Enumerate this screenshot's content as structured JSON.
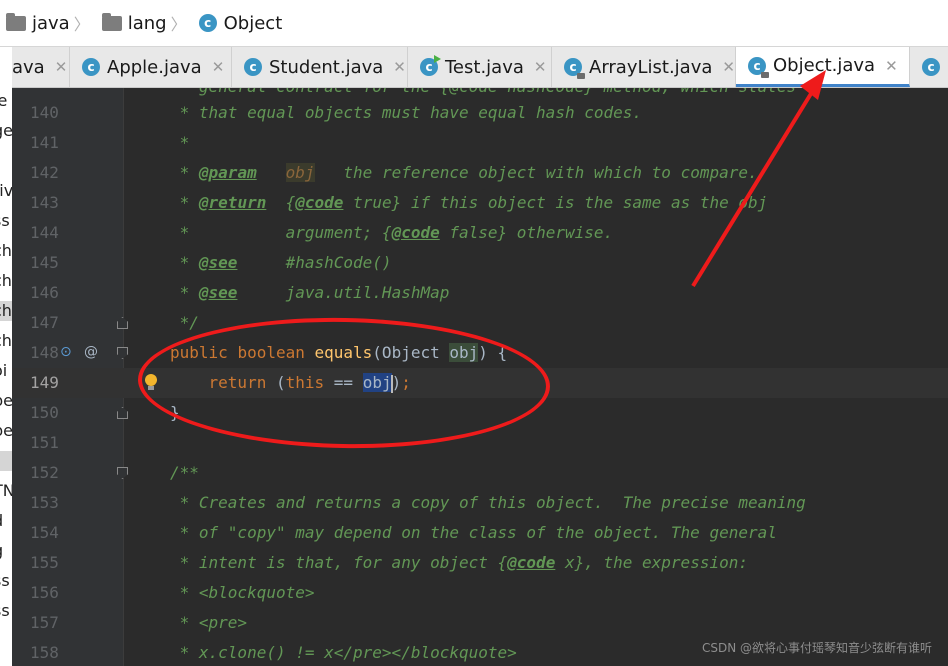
{
  "breadcrumb": {
    "items": [
      {
        "label": "java",
        "icon": "folder-icon"
      },
      {
        "label": "lang",
        "icon": "folder-icon"
      },
      {
        "label": "Object",
        "icon": "class-icon"
      }
    ]
  },
  "tabs": [
    {
      "label": "ava",
      "icon": "",
      "active": false
    },
    {
      "label": "Apple.java",
      "icon": "class-icon",
      "active": false
    },
    {
      "label": "Student.java",
      "icon": "class-icon",
      "active": false
    },
    {
      "label": "Test.java",
      "icon": "test-class-icon",
      "active": false
    },
    {
      "label": "ArrayList.java",
      "icon": "locked-class-icon",
      "active": false
    },
    {
      "label": "Object.java",
      "icon": "locked-class-icon",
      "active": true
    },
    {
      "label": "I",
      "icon": "class-icon",
      "active": false
    }
  ],
  "tab_close_glyph": "✕",
  "left_panel": {
    "fragments": [
      "le",
      "ge",
      "",
      "tiv",
      "ss",
      "ch",
      "ch",
      "ch",
      "ch",
      "oi",
      "pe",
      "pe",
      "t",
      "TN",
      "d",
      "g",
      "ss",
      "ss"
    ]
  },
  "editor": {
    "lines": [
      {
        "num": "140",
        "segments": [
          {
            "t": " * that equal objects must have equal hash codes.",
            "c": "doc"
          }
        ]
      },
      {
        "num": "141",
        "segments": [
          {
            "t": " *",
            "c": "doc"
          }
        ]
      },
      {
        "num": "142",
        "segments": [
          {
            "t": " * ",
            "c": "doc"
          },
          {
            "t": "@param",
            "c": "tag"
          },
          {
            "t": "   ",
            "c": "doc"
          },
          {
            "t": "obj",
            "c": "param"
          },
          {
            "t": "   the reference object with which to compare.",
            "c": "doc"
          }
        ]
      },
      {
        "num": "143",
        "segments": [
          {
            "t": " * ",
            "c": "doc"
          },
          {
            "t": "@return",
            "c": "tag"
          },
          {
            "t": "  {",
            "c": "doc"
          },
          {
            "t": "@code",
            "c": "tag"
          },
          {
            "t": " true} if this object is the same as the obj",
            "c": "doc"
          }
        ]
      },
      {
        "num": "144",
        "segments": [
          {
            "t": " *          argument; {",
            "c": "doc"
          },
          {
            "t": "@code",
            "c": "tag"
          },
          {
            "t": " false} otherwise.",
            "c": "doc"
          }
        ]
      },
      {
        "num": "145",
        "segments": [
          {
            "t": " * ",
            "c": "doc"
          },
          {
            "t": "@see",
            "c": "tag"
          },
          {
            "t": "     #hashCode()",
            "c": "doc"
          }
        ]
      },
      {
        "num": "146",
        "segments": [
          {
            "t": " * ",
            "c": "doc"
          },
          {
            "t": "@see",
            "c": "tag"
          },
          {
            "t": "     java.util.HashMap",
            "c": "doc"
          }
        ]
      },
      {
        "num": "147",
        "segments": [
          {
            "t": " */",
            "c": "doc"
          }
        ]
      },
      {
        "num": "148",
        "segments": [
          {
            "t": "public ",
            "c": "kw"
          },
          {
            "t": "boolean ",
            "c": "kw"
          },
          {
            "t": "equals",
            "c": "fn"
          },
          {
            "t": "(Object ",
            "c": "plain"
          },
          {
            "t": "obj",
            "c": "varhl"
          },
          {
            "t": ") {",
            "c": "plain"
          }
        ]
      },
      {
        "num": "149",
        "current": true,
        "segments": [
          {
            "t": "    return ",
            "c": "kw"
          },
          {
            "t": "(",
            "c": "plain"
          },
          {
            "t": "this ",
            "c": "kw"
          },
          {
            "t": "== ",
            "c": "plain"
          },
          {
            "t": "obj",
            "c": "sel-word"
          },
          {
            "t": ")",
            "c": "plain"
          },
          {
            "t": ";",
            "c": "kw"
          }
        ]
      },
      {
        "num": "150",
        "segments": [
          {
            "t": "}",
            "c": "plain"
          }
        ]
      },
      {
        "num": "151",
        "segments": []
      },
      {
        "num": "152",
        "segments": [
          {
            "t": "/**",
            "c": "doc"
          }
        ]
      },
      {
        "num": "153",
        "segments": [
          {
            "t": " * Creates and returns a copy of this object.  The precise meaning",
            "c": "doc"
          }
        ]
      },
      {
        "num": "154",
        "segments": [
          {
            "t": " * of \"copy\" may depend on the class of the object. The general",
            "c": "doc"
          }
        ]
      },
      {
        "num": "155",
        "segments": [
          {
            "t": " * intent is that, for any object {",
            "c": "doc"
          },
          {
            "t": "@code",
            "c": "tag"
          },
          {
            "t": " x}, the expression:",
            "c": "doc"
          }
        ]
      },
      {
        "num": "156",
        "segments": [
          {
            "t": " * <blockquote>",
            "c": "doc"
          }
        ]
      },
      {
        "num": "157",
        "segments": [
          {
            "t": " * <pre>",
            "c": "doc"
          }
        ]
      },
      {
        "num": "158",
        "segments": [
          {
            "t": " * x.clone() != x</pre></blockquote>",
            "c": "doc"
          }
        ]
      }
    ],
    "partial_top_line": " * general contract for the {@code hashCode} method, which states"
  },
  "gutter_markers": {
    "overrides_icon": "override-method-icon",
    "at_icon": "@"
  },
  "colors": {
    "annotation": "#ee1b1b",
    "active_tab_underline": "#4083c9",
    "doc_comment": "#629755",
    "keyword": "#cc7832",
    "function": "#ffc66d"
  },
  "watermark": "CSDN @欲将心事付瑶琴知音少弦断有谁听"
}
